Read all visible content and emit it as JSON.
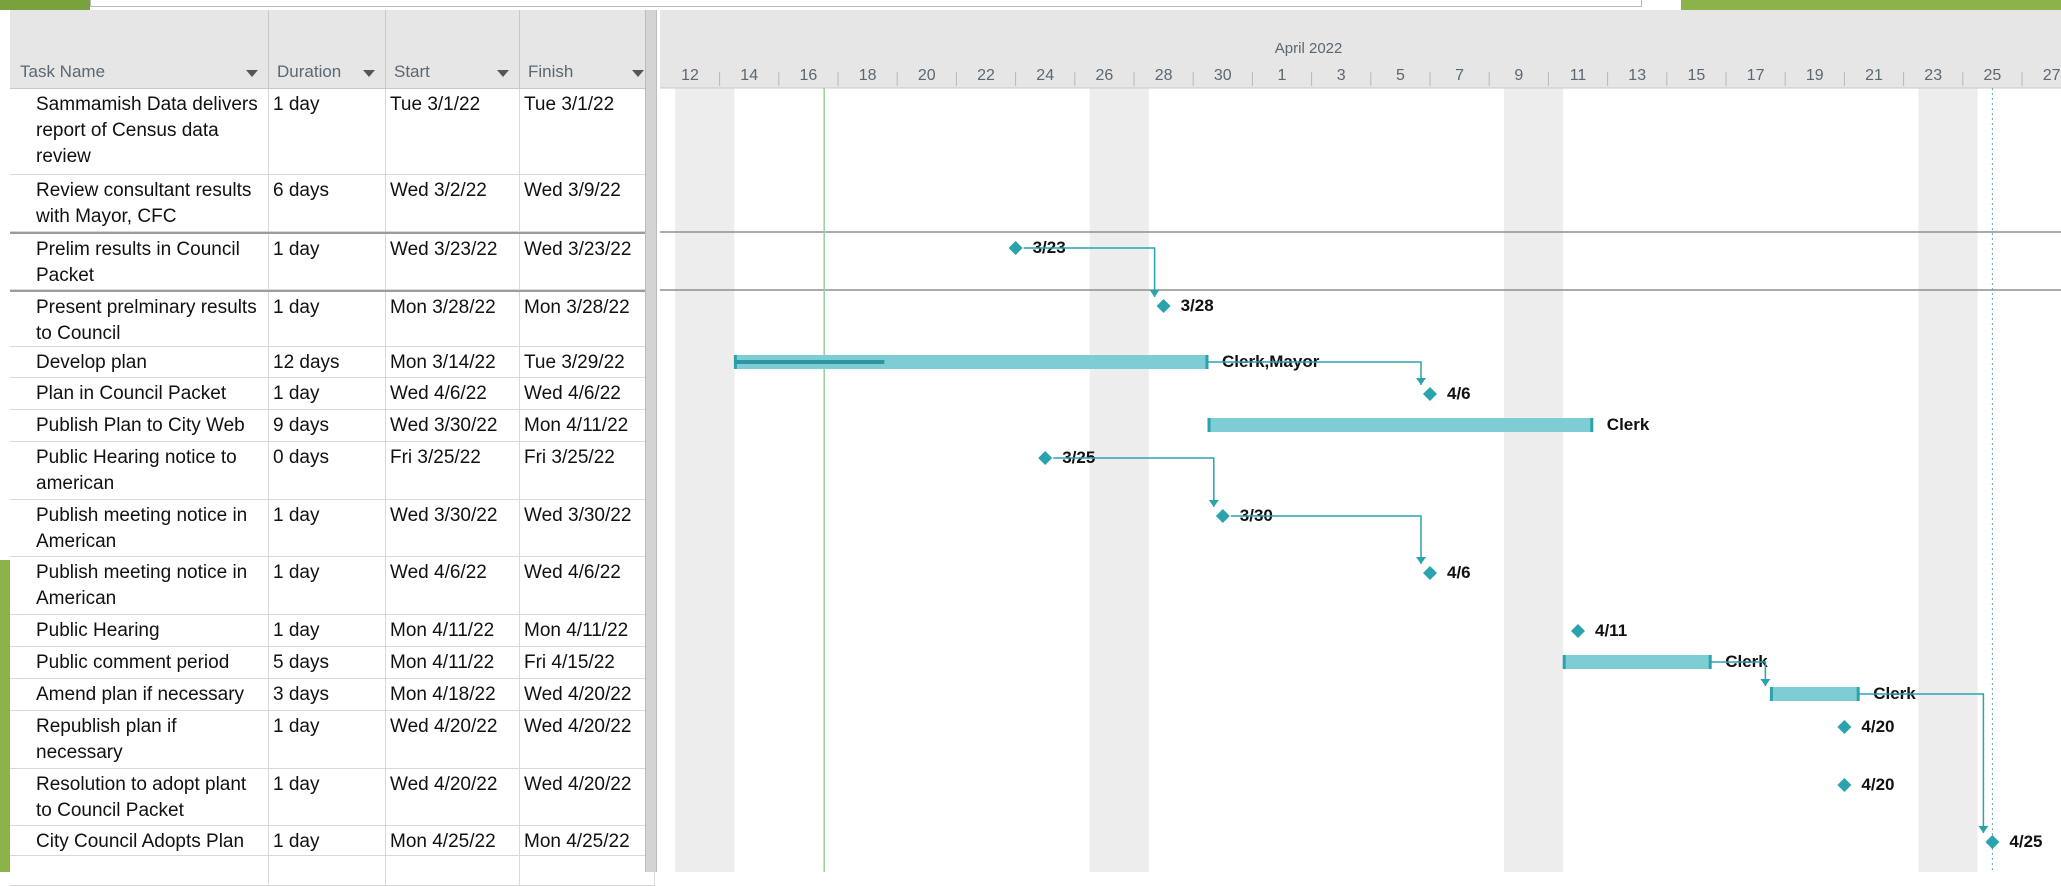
{
  "columns": {
    "task_name": "Task Name",
    "duration": "Duration",
    "start": "Start",
    "finish": "Finish"
  },
  "timescale": {
    "month_label": "April 2022",
    "ticks": [
      "12",
      "14",
      "16",
      "18",
      "20",
      "22",
      "24",
      "26",
      "28",
      "30",
      "1",
      "3",
      "5",
      "7",
      "9",
      "11",
      "13",
      "15",
      "17",
      "19",
      "21",
      "23",
      "25",
      "27"
    ]
  },
  "tasks": [
    {
      "name": "Sammamish Data delivers report of Census data review",
      "duration": "1 day",
      "start": "Tue 3/1/22",
      "finish": "Tue 3/1/22",
      "label": ""
    },
    {
      "name": "Review consultant results with Mayor, CFC",
      "duration": "6 days",
      "start": "Wed 3/2/22",
      "finish": "Wed 3/9/22",
      "label": ""
    },
    {
      "name": "Prelim results in Council Packet",
      "duration": "1 day",
      "start": "Wed 3/23/22",
      "finish": "Wed 3/23/22",
      "label": "3/23"
    },
    {
      "name": "Present prelminary results to Council",
      "duration": "1 day",
      "start": "Mon 3/28/22",
      "finish": "Mon 3/28/22",
      "label": "3/28"
    },
    {
      "name": "Develop plan",
      "duration": "12 days",
      "start": "Mon 3/14/22",
      "finish": "Tue 3/29/22",
      "label": "Clerk,Mayor"
    },
    {
      "name": "Plan in Council Packet",
      "duration": "1 day",
      "start": "Wed 4/6/22",
      "finish": "Wed 4/6/22",
      "label": "4/6"
    },
    {
      "name": "Publish Plan to City Web",
      "duration": "9 days",
      "start": "Wed 3/30/22",
      "finish": "Mon 4/11/22",
      "label": "Clerk"
    },
    {
      "name": "Public Hearing notice to american",
      "duration": "0 days",
      "start": "Fri 3/25/22",
      "finish": "Fri 3/25/22",
      "label": "3/25"
    },
    {
      "name": "Publish meeting notice in American",
      "duration": "1 day",
      "start": "Wed 3/30/22",
      "finish": "Wed 3/30/22",
      "label": "3/30"
    },
    {
      "name": "Publish meeting notice in American",
      "duration": "1 day",
      "start": "Wed 4/6/22",
      "finish": "Wed 4/6/22",
      "label": "4/6"
    },
    {
      "name": "Public Hearing",
      "duration": "1 day",
      "start": "Mon 4/11/22",
      "finish": "Mon 4/11/22",
      "label": "4/11"
    },
    {
      "name": "Public comment period",
      "duration": "5 days",
      "start": "Mon 4/11/22",
      "finish": "Fri 4/15/22",
      "label": "Clerk"
    },
    {
      "name": "Amend plan if necessary",
      "duration": "3 days",
      "start": "Mon 4/18/22",
      "finish": "Wed 4/20/22",
      "label": "Clerk"
    },
    {
      "name": "Republish plan if necessary",
      "duration": "1 day",
      "start": "Wed 4/20/22",
      "finish": "Wed 4/20/22",
      "label": "4/20"
    },
    {
      "name": "Resolution to adopt plant to Council Packet",
      "duration": "1 day",
      "start": "Wed 4/20/22",
      "finish": "Wed 4/20/22",
      "label": "4/20"
    },
    {
      "name": "City Council Adopts Plan",
      "duration": "1 day",
      "start": "Mon 4/25/22",
      "finish": "Mon 4/25/22",
      "label": "4/25"
    }
  ],
  "colors": {
    "bar_fill": "#7fcdd4",
    "bar_edge": "#2aa3ad",
    "milestone": "#2aa3ad",
    "progress": "#2a97a2",
    "weekend_shade": "#ededed",
    "header_bg": "#e6e6e6",
    "today_line": "#9ccc9c"
  }
}
